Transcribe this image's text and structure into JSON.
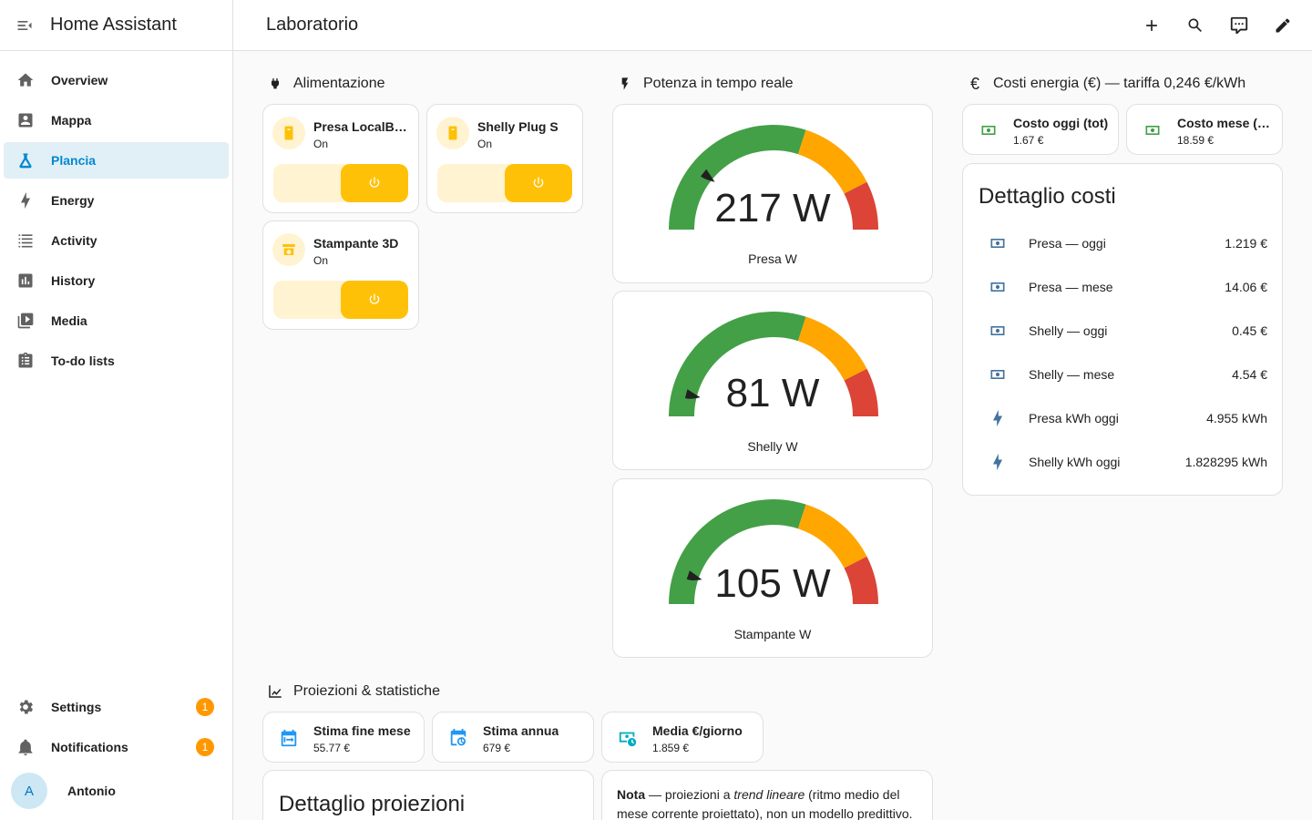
{
  "app": {
    "title": "Home Assistant"
  },
  "sidebar": {
    "items": [
      {
        "label": "Overview",
        "icon": "home-icon"
      },
      {
        "label": "Mappa",
        "icon": "account-box-icon"
      },
      {
        "label": "Plancia",
        "icon": "flask-icon",
        "active": true
      },
      {
        "label": "Energy",
        "icon": "lightning-icon"
      },
      {
        "label": "Activity",
        "icon": "list-icon"
      },
      {
        "label": "History",
        "icon": "chart-box-icon"
      },
      {
        "label": "Media",
        "icon": "play-box-icon"
      },
      {
        "label": "To-do lists",
        "icon": "clipboard-list-icon"
      }
    ],
    "settings": {
      "label": "Settings",
      "badge": "1"
    },
    "notifications": {
      "label": "Notifications",
      "badge": "1"
    },
    "user": {
      "name": "Antonio",
      "initial": "A"
    }
  },
  "header": {
    "title": "Laboratorio"
  },
  "sections": {
    "power": "Alimentazione",
    "realtime": "Potenza in tempo reale",
    "costs": "Costi energia (€) — tariffa 0,246 €/kWh",
    "projections": "Proiezioni & statistiche"
  },
  "switches": [
    {
      "name": "Presa LocalBytes",
      "state": "On"
    },
    {
      "name": "Shelly Plug S",
      "state": "On"
    },
    {
      "name": "Stampante 3D",
      "state": "On"
    }
  ],
  "gauges": [
    {
      "value": 217,
      "unit": "W",
      "label": "Presa W",
      "min": 0,
      "max": 1000
    },
    {
      "value": 81,
      "unit": "W",
      "label": "Shelly W",
      "min": 0,
      "max": 1000
    },
    {
      "value": 105,
      "unit": "W",
      "label": "Stampante W",
      "min": 0,
      "max": 1000
    }
  ],
  "cost_tiles": [
    {
      "name": "Costo oggi (tot)",
      "value": "1.67 €"
    },
    {
      "name": "Costo mese (tot)",
      "value": "18.59 €"
    }
  ],
  "cost_detail": {
    "title": "Dettaglio costi",
    "rows": [
      {
        "name": "Presa — oggi",
        "value": "1.219 €",
        "icon": "cash-icon"
      },
      {
        "name": "Presa — mese",
        "value": "14.06 €",
        "icon": "cash-icon"
      },
      {
        "name": "Shelly — oggi",
        "value": "0.45 €",
        "icon": "cash-icon"
      },
      {
        "name": "Shelly — mese",
        "value": "4.54 €",
        "icon": "cash-icon"
      },
      {
        "name": "Presa kWh oggi",
        "value": "4.955 kWh",
        "icon": "lightning-icon"
      },
      {
        "name": "Shelly kWh oggi",
        "value": "1.828295 kWh",
        "icon": "lightning-icon"
      }
    ]
  },
  "projection_tiles": [
    {
      "name": "Stima fine mese",
      "value": "55.77 €",
      "icon": "calendar-arrow-icon"
    },
    {
      "name": "Stima annua",
      "value": "679 €",
      "icon": "calendar-clock-icon"
    },
    {
      "name": "Media €/giorno",
      "value": "1.859 €",
      "icon": "cash-clock-icon"
    }
  ],
  "projection_detail": {
    "title": "Dettaglio proiezioni"
  },
  "note": {
    "bold": "Nota",
    "text1": " — proiezioni a ",
    "italic": "trend lineare",
    "text2": " (ritmo medio del mese corrente proiettato), non un modello predittivo."
  },
  "colors": {
    "accent": "#0288d1",
    "green": "#43a047",
    "orange": "#ffa600",
    "red": "#db4437",
    "switch_on": "#ffc107"
  }
}
